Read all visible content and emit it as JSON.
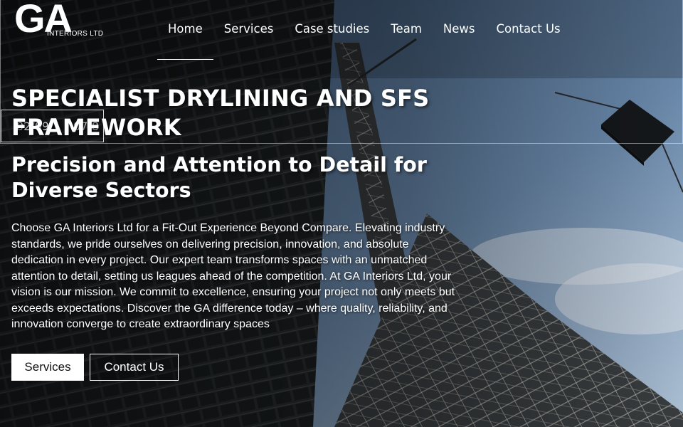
{
  "brand": {
    "logo_mark": "GA",
    "logo_sub": "INTERIORS LTD"
  },
  "nav": {
    "items": [
      {
        "label": "Home",
        "active": true
      },
      {
        "label": "Services",
        "active": false
      },
      {
        "label": "Case studies",
        "active": false
      },
      {
        "label": "Team",
        "active": false
      },
      {
        "label": "News",
        "active": false
      },
      {
        "label": "Contact Us",
        "active": false
      }
    ]
  },
  "slider": {
    "current": "02/09",
    "total": "07/8"
  },
  "hero": {
    "title": "SPECIALIST DRYLINING AND SFS FRAMEWORK",
    "subtitle": "Precision and Attention to Detail for Diverse Sectors",
    "description": "Choose GA Interiors Ltd for a Fit-Out Experience Beyond Compare. Elevating industry standards, we pride ourselves on delivering precision, innovation, and absolute dedication in every project. Our expert team transforms spaces with an unmatched attention to detail, setting us leagues ahead of the competition. At GA Interiors Ltd, your vision is our mission. We commit to excellence, ensuring your project not only meets but exceeds expectations. Discover the GA difference today – where quality, reliability, and innovation converge to create extraordinary spaces"
  },
  "cta": {
    "primary_label": "Services",
    "secondary_label": "Contact Us"
  },
  "colors": {
    "sky_top": "#4a6a8f",
    "sky_bottom": "#a8c0d8",
    "structure": "#2a2e31",
    "text": "#ffffff"
  }
}
